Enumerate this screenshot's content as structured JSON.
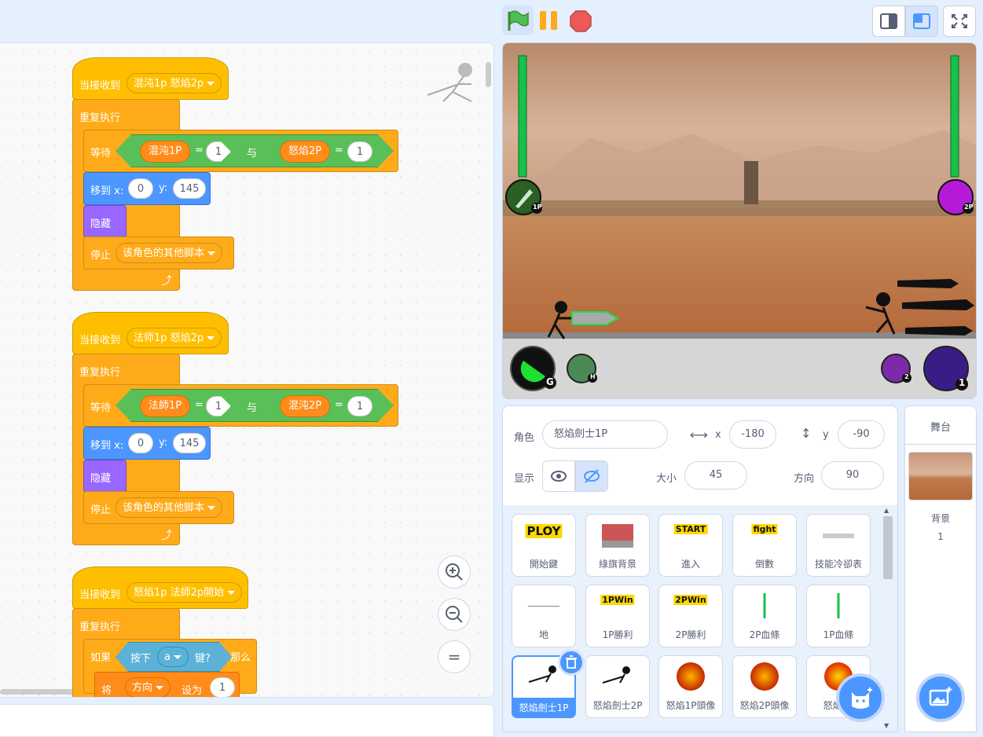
{
  "colors": {
    "events": "#ffbf00",
    "control": "#ffab19",
    "motion": "#4c97ff",
    "looks": "#9966ff",
    "operators": "#59c059",
    "variables": "#ff8c1a",
    "sensing": "#5cb1d6",
    "accent": "#4c97ff"
  },
  "scripts": [
    {
      "hat": "当接收到",
      "message": "混沌1p 怒焰2p",
      "forever": "重复执行",
      "wait": "等待",
      "left_var": "混沌1P",
      "left_eq": "=",
      "left_val": "1",
      "and": "与",
      "right_var": "怒焰2P",
      "right_eq": "=",
      "right_val": "1",
      "goto": "移到 x:",
      "x": "0",
      "y_label": "y:",
      "y": "145",
      "hide": "隐藏",
      "stop": "停止",
      "stop_opt": "该角色的其他脚本"
    },
    {
      "hat": "当接收到",
      "message": "法师1p 怒焰2p",
      "forever": "重复执行",
      "wait": "等待",
      "left_var": "法師1P",
      "left_eq": "=",
      "left_val": "1",
      "and": "与",
      "right_var": "混沌2P",
      "right_eq": "=",
      "right_val": "1",
      "goto": "移到 x:",
      "x": "0",
      "y_label": "y:",
      "y": "145",
      "hide": "隐藏",
      "stop": "停止",
      "stop_opt": "该角色的其他脚本"
    },
    {
      "hat": "当接收到",
      "message": "怒焰1p 法師2p開始",
      "forever": "重复执行",
      "if": "如果",
      "press": "按下",
      "key": "a",
      "key_q": "键?",
      "then": "那么",
      "set_label": "将",
      "set_var": "方向",
      "set_to": "设为",
      "set_val": "1"
    }
  ],
  "zoom": {
    "in": "+",
    "out": "−",
    "reset": "="
  },
  "icons": {
    "flag": "green-flag-icon",
    "pause": "pause-icon",
    "stop": "stop-icon",
    "small_stage": "small-stage-icon",
    "normal_stage": "normal-stage-icon",
    "fullscreen": "fullscreen-icon"
  },
  "stage_hud": {
    "p1_tag": "1P",
    "p2_tag": "2P",
    "skill_g": "G",
    "skill_h": "H",
    "p2_skill_2": "2",
    "p2_skill_1": "1"
  },
  "sprite_info": {
    "sprite_label": "角色",
    "sprite_name": "怒焰劍士1P",
    "x_label": "x",
    "x": "-180",
    "y_label": "y",
    "y": "-90",
    "show_label": "显示",
    "size_label": "大小",
    "size": "45",
    "direction_label": "方向",
    "direction": "90"
  },
  "sprites": [
    {
      "name": "開始鍵",
      "thumb": "PLOY"
    },
    {
      "name": "綠旗背景",
      "thumb": ""
    },
    {
      "name": "進入",
      "thumb": "START"
    },
    {
      "name": "倒數",
      "thumb": "fight"
    },
    {
      "name": "技能冷卻表",
      "thumb": ""
    },
    {
      "name": "地",
      "thumb": ""
    },
    {
      "name": "1P勝利",
      "thumb": "1PWin"
    },
    {
      "name": "2P勝利",
      "thumb": "2PWin"
    },
    {
      "name": "2P血條",
      "thumb": ""
    },
    {
      "name": "1P血條",
      "thumb": ""
    },
    {
      "name": "怒焰劍士1P",
      "thumb": ""
    },
    {
      "name": "怒焰劍士2P",
      "thumb": ""
    },
    {
      "name": "怒焰1P頭像",
      "thumb": ""
    },
    {
      "name": "怒焰2P頭像",
      "thumb": ""
    },
    {
      "name": "怒焰1P",
      "thumb": ""
    }
  ],
  "stage_panel": {
    "title": "舞台",
    "backdrop_label": "背景",
    "backdrop_count": "1"
  }
}
